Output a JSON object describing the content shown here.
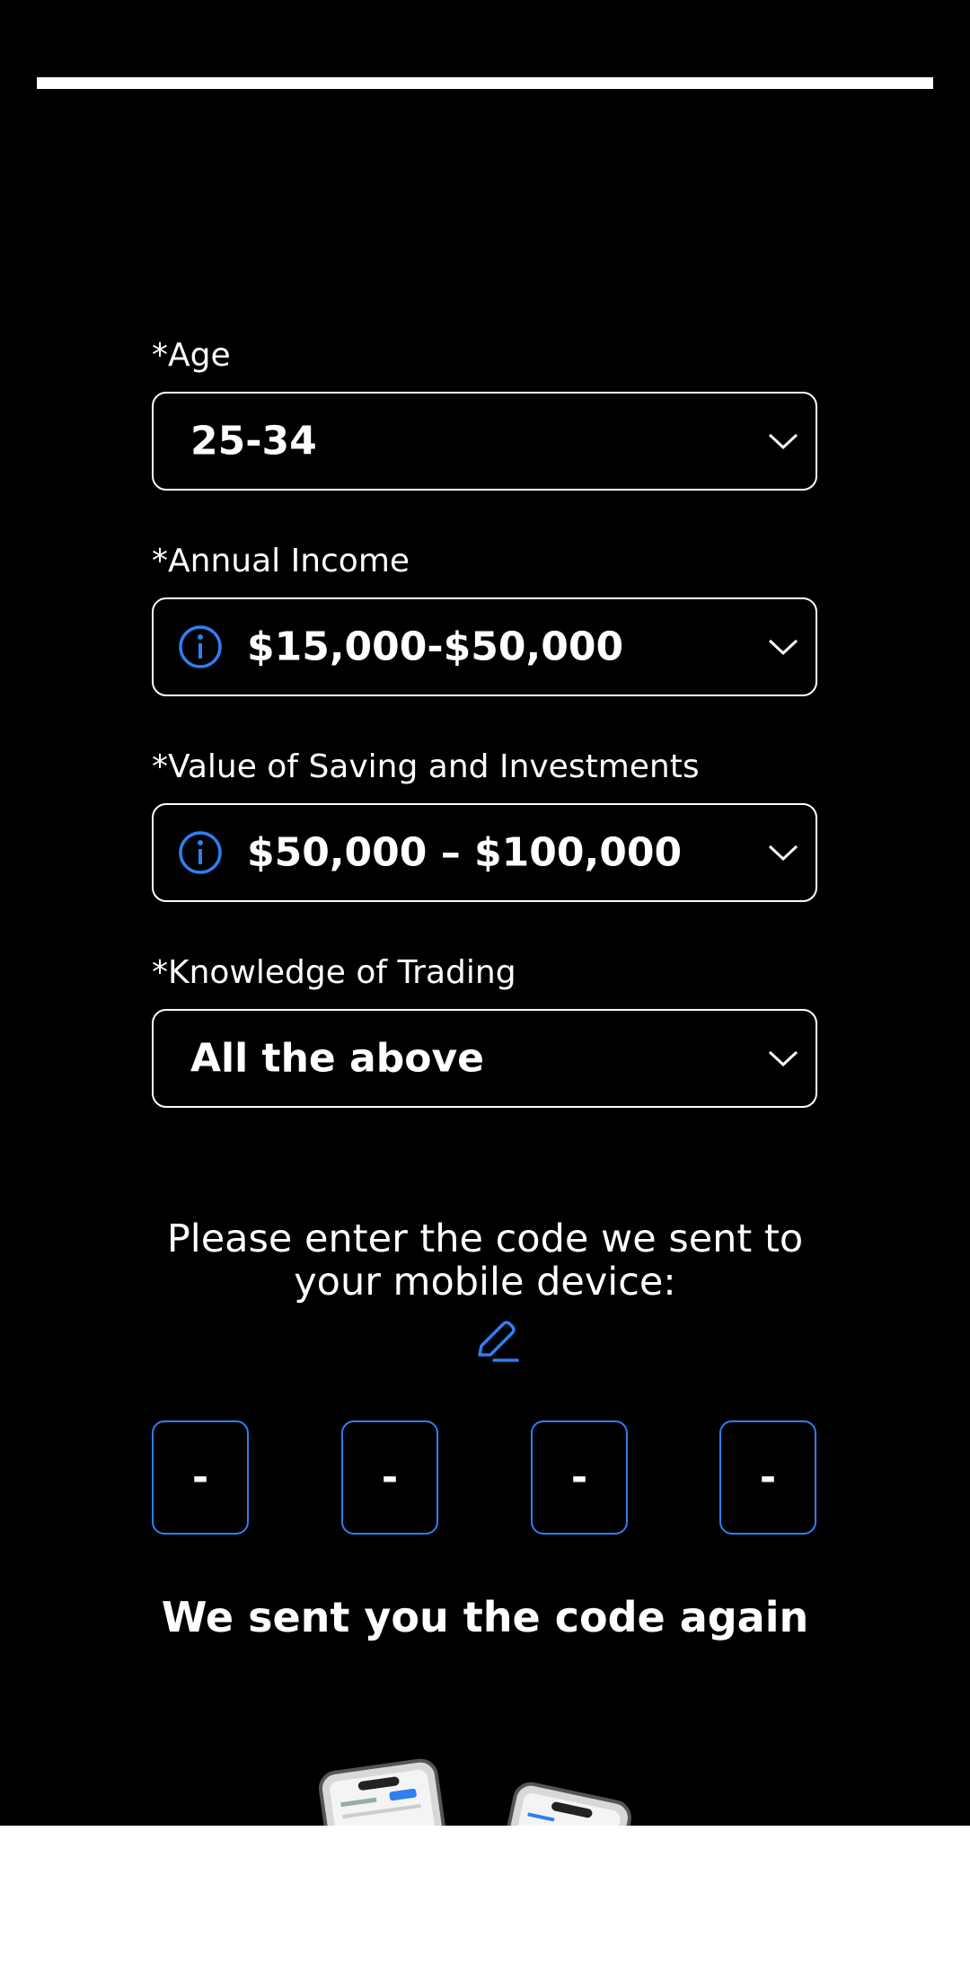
{
  "progress": {
    "fraction": 1.0
  },
  "form": {
    "age": {
      "label": "*Age",
      "value": "25-34"
    },
    "income": {
      "label": "*Annual Income",
      "value": "$15,000-$50,000",
      "icon": "info-icon"
    },
    "savings": {
      "label": "*Value of Saving and Investments",
      "value": "$50,000 – $100,000",
      "icon": "info-icon"
    },
    "knowledge": {
      "label": "*Knowledge of Trading",
      "value": "All the above"
    }
  },
  "verification": {
    "prompt": "Please enter the code we sent to your mobile device:",
    "edit_icon": "pencil-icon",
    "digits": [
      "-",
      "-",
      "-",
      "-"
    ],
    "resent_message": "We sent you the code again"
  },
  "colors": {
    "background": "#000000",
    "text": "#ffffff",
    "accent": "#2f7ff0",
    "bottom_area": "#ffffff"
  }
}
